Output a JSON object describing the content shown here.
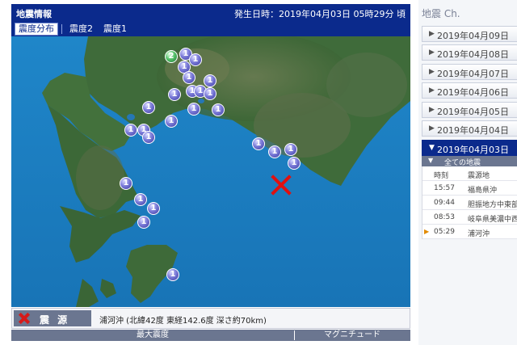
{
  "header": {
    "title": "地震情報",
    "time_label": "発生日時：",
    "time_value": "2019年04月03日 05時29分 頃"
  },
  "tabs": {
    "items": [
      {
        "label": "震度分布",
        "active": true
      },
      {
        "label": "震度2",
        "active": false
      },
      {
        "label": "震度1",
        "active": false
      }
    ]
  },
  "map": {
    "markers": [
      "2",
      "1",
      "1",
      "1",
      "1",
      "1",
      "1",
      "1",
      "1",
      "1",
      "1",
      "1",
      "1",
      "1",
      "1",
      "1",
      "1",
      "1",
      "1",
      "1",
      "1",
      "1",
      "1",
      "1",
      "1",
      "1"
    ]
  },
  "info": {
    "label": "震 源",
    "text": "浦河沖 (北緯42度 東経142.6度 深さ約70km)"
  },
  "bottombar": {
    "max_intensity": "最大震度",
    "magnitude": "マグニチュード"
  },
  "sidebar": {
    "title": "地震 Ch.",
    "dates": [
      {
        "label": "2019年04月09日",
        "active": false
      },
      {
        "label": "2019年04月08日",
        "active": false
      },
      {
        "label": "2019年04月07日",
        "active": false
      },
      {
        "label": "2019年04月06日",
        "active": false
      },
      {
        "label": "2019年04月05日",
        "active": false
      },
      {
        "label": "2019年04月04日",
        "active": false
      },
      {
        "label": "2019年04月03日",
        "active": true
      }
    ],
    "filter_label": "全ての地震",
    "table_header": {
      "time": "時刻",
      "place": "震源地"
    },
    "events": [
      {
        "time": "15:57",
        "place": "福島県沖",
        "current": false
      },
      {
        "time": "09:44",
        "place": "胆振地方中東部",
        "current": false
      },
      {
        "time": "08:53",
        "place": "岐阜県美濃中西部",
        "current": false
      },
      {
        "time": "05:29",
        "place": "浦河沖",
        "current": true
      }
    ]
  },
  "colors": {
    "header_bg": "#0b2a8c",
    "sea": "#1c7ec2",
    "land": "#3f6b3a",
    "epicenter": "#e01010",
    "marker_int1": "#6a6ad0",
    "marker_int2": "#4fbf68"
  }
}
